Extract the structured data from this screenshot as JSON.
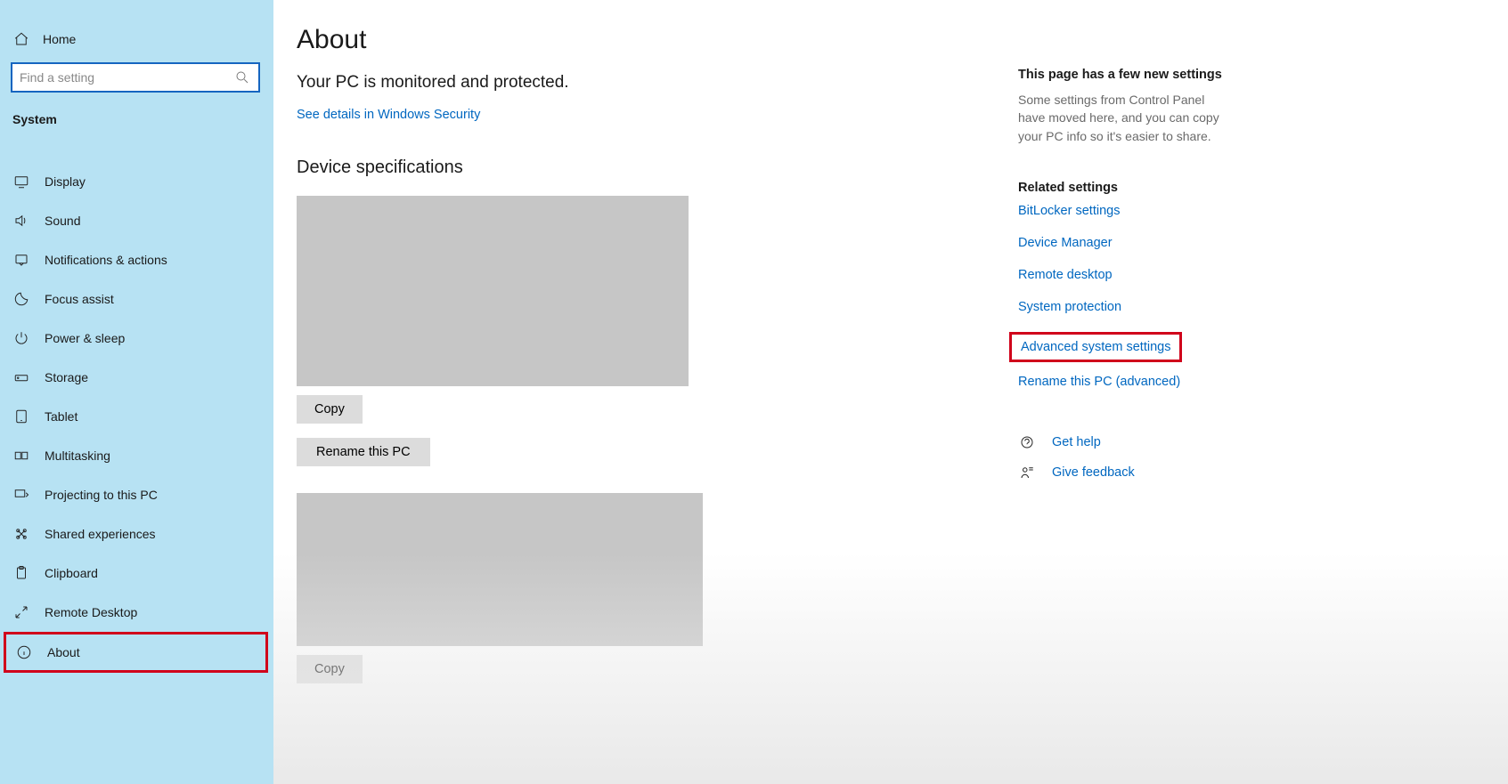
{
  "sidebar": {
    "home": "Home",
    "search_placeholder": "Find a setting",
    "section": "System",
    "items": [
      {
        "label": "Display"
      },
      {
        "label": "Sound"
      },
      {
        "label": "Notifications & actions"
      },
      {
        "label": "Focus assist"
      },
      {
        "label": "Power & sleep"
      },
      {
        "label": "Storage"
      },
      {
        "label": "Tablet"
      },
      {
        "label": "Multitasking"
      },
      {
        "label": "Projecting to this PC"
      },
      {
        "label": "Shared experiences"
      },
      {
        "label": "Clipboard"
      },
      {
        "label": "Remote Desktop"
      },
      {
        "label": "About"
      }
    ]
  },
  "main": {
    "title": "About",
    "status": "Your PC is monitored and protected.",
    "security_link": "See details in Windows Security",
    "device_spec_heading": "Device specifications",
    "copy1": "Copy",
    "rename": "Rename this PC",
    "copy2": "Copy"
  },
  "rail": {
    "new_heading": "This page has a few new settings",
    "new_text": "Some settings from Control Panel have moved here, and you can copy your PC info so it's easier to share.",
    "related_heading": "Related settings",
    "links": {
      "bitlocker": "BitLocker settings",
      "devmgr": "Device Manager",
      "remote": "Remote desktop",
      "sysprot": "System protection",
      "advanced": "Advanced system settings",
      "renameadv": "Rename this PC (advanced)"
    },
    "help": "Get help",
    "feedback": "Give feedback"
  }
}
